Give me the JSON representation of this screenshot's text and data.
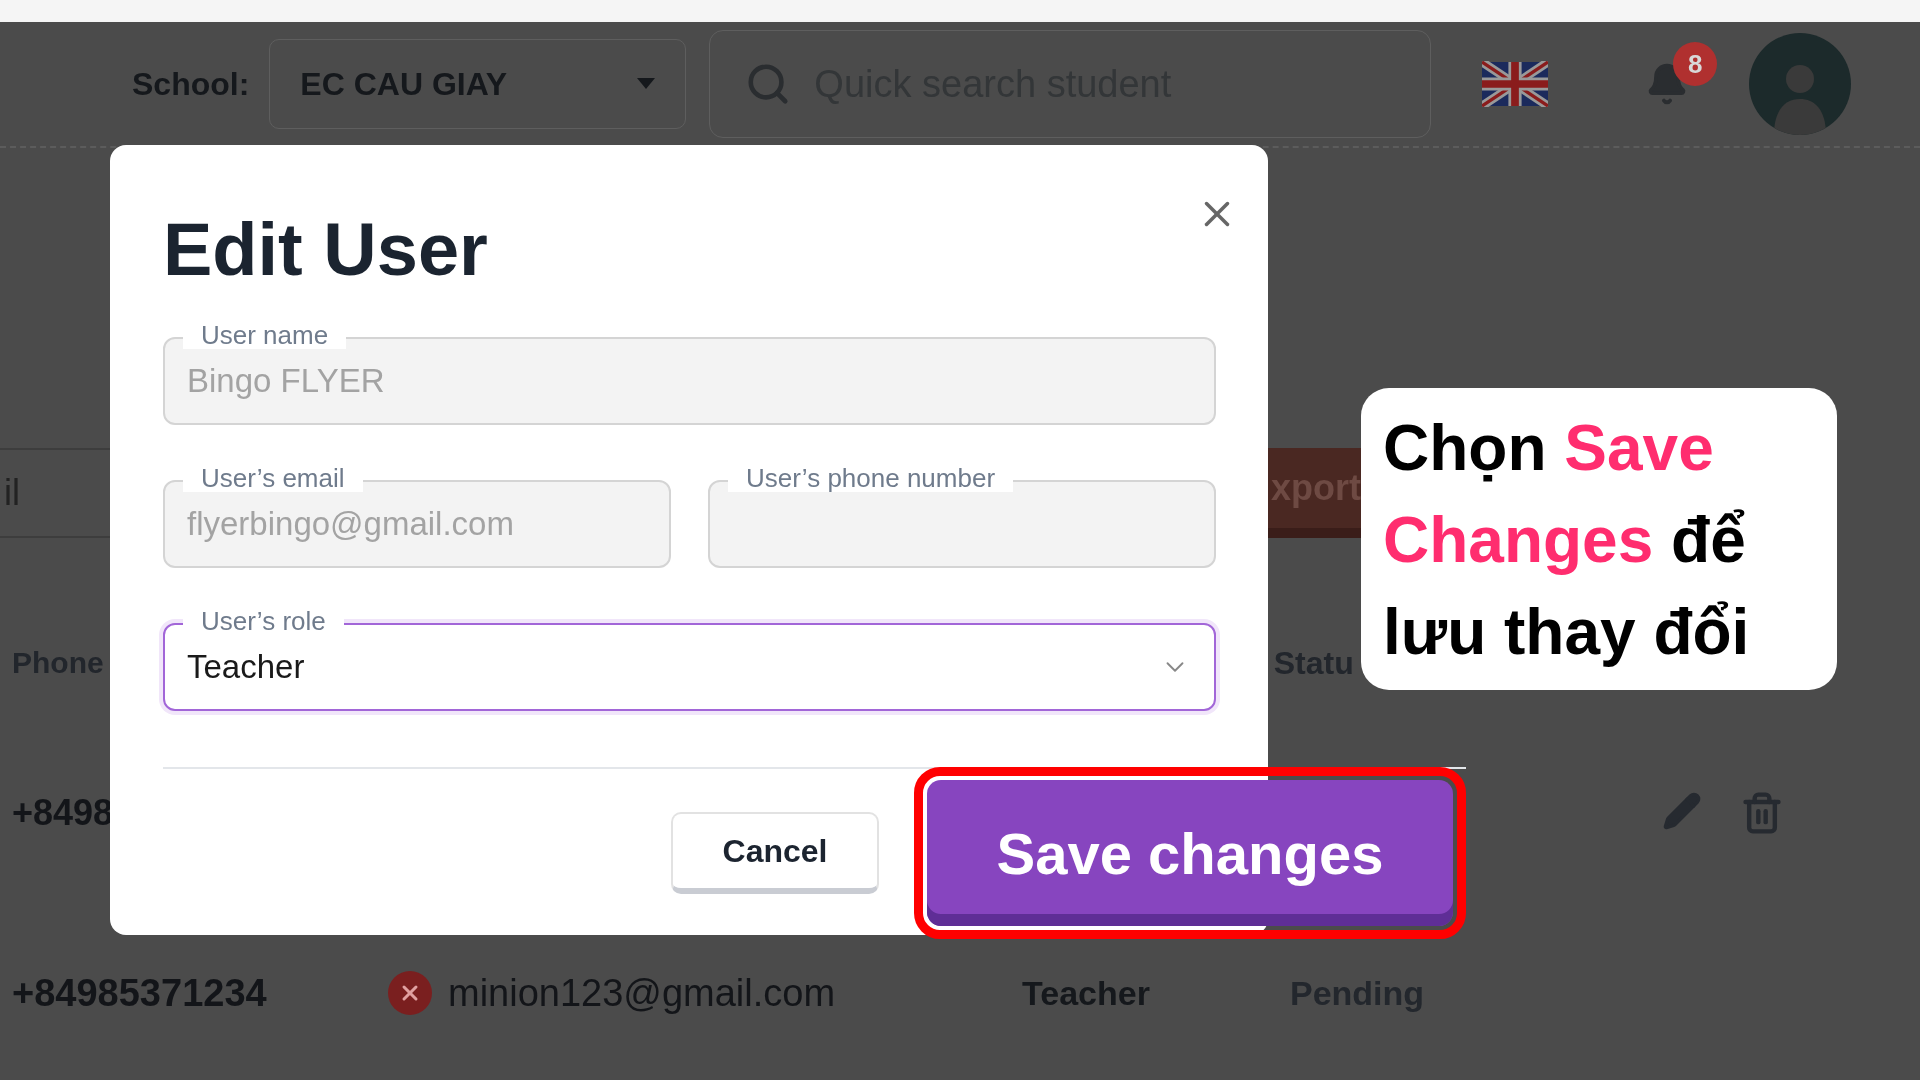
{
  "header": {
    "school_label": "School:",
    "school_value": "EC CAU GIAY",
    "search": {
      "placeholder": "Quick search student"
    },
    "notifications": "8"
  },
  "background": {
    "filter_field": "il",
    "export_button": "xport",
    "columns": [
      "Phone",
      "Statu"
    ],
    "rows": [
      {
        "phone": "+8498",
        "actions": true
      },
      {
        "phone": "+84985371234",
        "verified": false,
        "email": "minion123@gmail.com",
        "role": "Teacher",
        "status": "Pending",
        "actions": false
      }
    ]
  },
  "dialog": {
    "title": "Edit User",
    "fields": [
      {
        "kind": "text",
        "label": "User name",
        "value": "Bingo FLYER",
        "disabled": true,
        "focused": false
      },
      {
        "kind": "text",
        "label": "User’s email",
        "value": "flyerbingo@gmail.com",
        "disabled": true,
        "focused": false
      },
      {
        "kind": "text",
        "label": "User’s phone number",
        "disabled": true,
        "focused": false
      },
      {
        "kind": "select",
        "label": "User’s role",
        "value": "Teacher",
        "disabled": false,
        "focused": true
      }
    ],
    "cancel": "Cancel",
    "save": "Save changes"
  },
  "callout": {
    "parts": [
      {
        "text": "Chọn ",
        "highlight": false
      },
      {
        "text": "Save Changes",
        "highlight": true
      },
      {
        "text": " để lưu thay đổi",
        "highlight": false
      }
    ]
  }
}
